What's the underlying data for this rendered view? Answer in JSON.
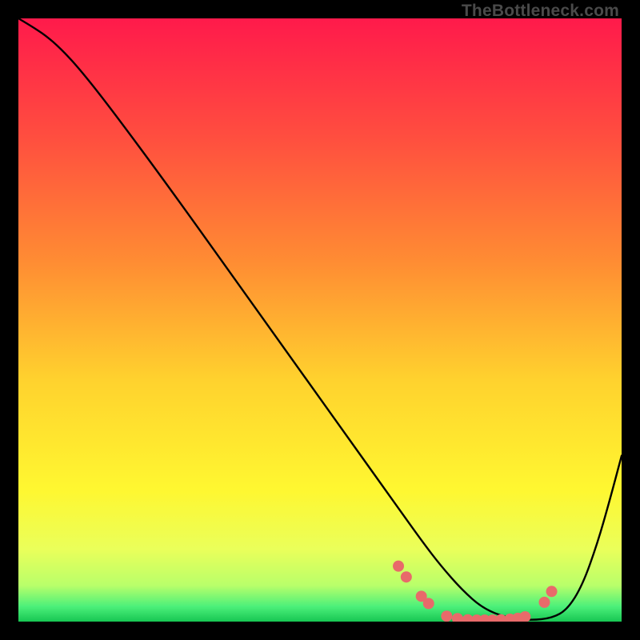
{
  "watermark": "TheBottleneck.com",
  "chart_data": {
    "type": "line",
    "title": "",
    "xlabel": "",
    "ylabel": "",
    "xlim": [
      0,
      100
    ],
    "ylim": [
      0,
      100
    ],
    "gradient_stops": [
      {
        "offset": 0.0,
        "color": "#ff1a4b"
      },
      {
        "offset": 0.2,
        "color": "#ff4f3f"
      },
      {
        "offset": 0.4,
        "color": "#ff8b33"
      },
      {
        "offset": 0.6,
        "color": "#ffd22e"
      },
      {
        "offset": 0.78,
        "color": "#fff730"
      },
      {
        "offset": 0.88,
        "color": "#eaff5a"
      },
      {
        "offset": 0.94,
        "color": "#b9ff6a"
      },
      {
        "offset": 0.975,
        "color": "#4cf07a"
      },
      {
        "offset": 1.0,
        "color": "#17c653"
      }
    ],
    "series": [
      {
        "name": "bottleneck-curve",
        "x": [
          0.0,
          2.0,
          4.5,
          7.0,
          10.0,
          15.0,
          25.0,
          40.0,
          55.0,
          62.0,
          67.0,
          70.0,
          73.5,
          77.0,
          81.0,
          85.0,
          88.5,
          91.0,
          93.5,
          96.0,
          98.0,
          100.0
        ],
        "y": [
          100.0,
          98.8,
          97.2,
          95.0,
          91.8,
          85.5,
          72.0,
          51.0,
          30.0,
          20.2,
          13.2,
          9.3,
          5.3,
          2.2,
          0.6,
          0.2,
          0.6,
          2.0,
          6.0,
          13.0,
          20.0,
          27.5
        ]
      }
    ],
    "dots": {
      "name": "highlight-dots",
      "color": "#e86a6a",
      "points": [
        {
          "x": 63.0,
          "y": 9.2
        },
        {
          "x": 64.3,
          "y": 7.4
        },
        {
          "x": 66.8,
          "y": 4.2
        },
        {
          "x": 68.0,
          "y": 3.0
        },
        {
          "x": 71.0,
          "y": 0.9
        },
        {
          "x": 72.8,
          "y": 0.5
        },
        {
          "x": 74.5,
          "y": 0.3
        },
        {
          "x": 76.0,
          "y": 0.25
        },
        {
          "x": 77.3,
          "y": 0.25
        },
        {
          "x": 78.6,
          "y": 0.25
        },
        {
          "x": 80.0,
          "y": 0.3
        },
        {
          "x": 81.5,
          "y": 0.4
        },
        {
          "x": 82.8,
          "y": 0.55
        },
        {
          "x": 84.0,
          "y": 0.8
        },
        {
          "x": 87.2,
          "y": 3.2
        },
        {
          "x": 88.4,
          "y": 5.0
        }
      ]
    }
  }
}
